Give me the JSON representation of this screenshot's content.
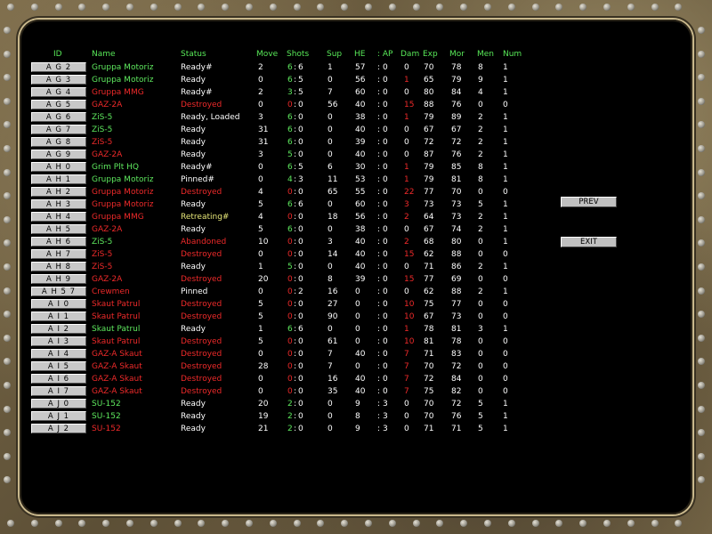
{
  "headers": {
    "id": "ID",
    "name": "Name",
    "status": "Status",
    "move": "Move",
    "shots": "Shots",
    "sup": "Sup",
    "he": "HE",
    "ap": ": AP",
    "dam": "Dam",
    "exp": "Exp",
    "mor": "Mor",
    "men": "Men",
    "num": "Num"
  },
  "colors": {
    "green": "#5ee85e",
    "red": "#ee2a2a",
    "white": "#ffffff",
    "yellow": "#e6e678"
  },
  "buttons": {
    "prev": "PREV",
    "exit": "EXIT"
  },
  "rows": [
    {
      "id": "AG2",
      "name": "Gruppa Motoriz",
      "nc": "g",
      "status": "Ready#",
      "sc": "w",
      "move": "2",
      "shots": "6",
      "sc2": "6",
      "sup": "1",
      "he": "57",
      "ap": "0",
      "dam": "0",
      "dc": "w",
      "exp": "70",
      "mor": "78",
      "men": "8",
      "num": "1"
    },
    {
      "id": "AG3",
      "name": "Gruppa Motoriz",
      "nc": "g",
      "status": "Ready",
      "sc": "w",
      "move": "0",
      "shots": "6",
      "sc2": "5",
      "sup": "0",
      "he": "56",
      "ap": "0",
      "dam": "1",
      "dc": "r",
      "exp": "65",
      "mor": "79",
      "men": "9",
      "num": "1"
    },
    {
      "id": "AG4",
      "name": "Gruppa MMG",
      "nc": "r",
      "status": "Ready#",
      "sc": "w",
      "move": "2",
      "shots": "3",
      "sc2": "5",
      "sup": "7",
      "he": "60",
      "ap": "0",
      "dam": "0",
      "dc": "w",
      "exp": "80",
      "mor": "84",
      "men": "4",
      "num": "1"
    },
    {
      "id": "AG5",
      "name": "GAZ-2A",
      "nc": "r",
      "status": "Destroyed",
      "sc": "r",
      "move": "0",
      "shots": "0",
      "sc2": "0",
      "sup": "56",
      "he": "40",
      "ap": "0",
      "dam": "15",
      "dc": "r",
      "exp": "88",
      "mor": "76",
      "men": "0",
      "num": "0"
    },
    {
      "id": "AG6",
      "name": "ZiS-5",
      "nc": "g",
      "status": "Ready,  Loaded",
      "sc": "w",
      "move": "3",
      "shots": "6",
      "sc2": "0",
      "sup": "0",
      "he": "38",
      "ap": "0",
      "dam": "1",
      "dc": "r",
      "exp": "79",
      "mor": "89",
      "men": "2",
      "num": "1"
    },
    {
      "id": "AG7",
      "name": "ZiS-5",
      "nc": "g",
      "status": "Ready",
      "sc": "w",
      "move": "31",
      "shots": "6",
      "sc2": "0",
      "sup": "0",
      "he": "40",
      "ap": "0",
      "dam": "0",
      "dc": "w",
      "exp": "67",
      "mor": "67",
      "men": "2",
      "num": "1"
    },
    {
      "id": "AG8",
      "name": "ZiS-5",
      "nc": "r",
      "status": "Ready",
      "sc": "w",
      "move": "31",
      "shots": "6",
      "sc2": "0",
      "sup": "0",
      "he": "39",
      "ap": "0",
      "dam": "0",
      "dc": "w",
      "exp": "72",
      "mor": "72",
      "men": "2",
      "num": "1"
    },
    {
      "id": "AG9",
      "name": "GAZ-2A",
      "nc": "r",
      "status": "Ready",
      "sc": "w",
      "move": "3",
      "shots": "5",
      "sc2": "0",
      "sup": "0",
      "he": "40",
      "ap": "0",
      "dam": "0",
      "dc": "w",
      "exp": "87",
      "mor": "76",
      "men": "2",
      "num": "1"
    },
    {
      "id": "AH0",
      "name": "Grim Plt HQ",
      "nc": "g",
      "status": "Ready#",
      "sc": "w",
      "move": "0",
      "shots": "6",
      "sc2": "5",
      "sup": "6",
      "he": "30",
      "ap": "0",
      "dam": "1",
      "dc": "r",
      "exp": "79",
      "mor": "85",
      "men": "8",
      "num": "1"
    },
    {
      "id": "AH1",
      "name": "Gruppa Motoriz",
      "nc": "g",
      "status": "Pinned#",
      "sc": "w",
      "move": "0",
      "shots": "4",
      "sc2": "3",
      "sup": "11",
      "he": "53",
      "ap": "0",
      "dam": "1",
      "dc": "r",
      "exp": "79",
      "mor": "81",
      "men": "8",
      "num": "1"
    },
    {
      "id": "AH2",
      "name": "Gruppa Motoriz",
      "nc": "r",
      "status": "Destroyed",
      "sc": "r",
      "move": "4",
      "shots": "0",
      "sc2": "0",
      "sup": "65",
      "he": "55",
      "ap": "0",
      "dam": "22",
      "dc": "r",
      "exp": "77",
      "mor": "70",
      "men": "0",
      "num": "0"
    },
    {
      "id": "AH3",
      "name": "Gruppa Motoriz",
      "nc": "r",
      "status": "Ready",
      "sc": "w",
      "move": "5",
      "shots": "6",
      "sc2": "6",
      "sup": "0",
      "he": "60",
      "ap": "0",
      "dam": "3",
      "dc": "r",
      "exp": "73",
      "mor": "73",
      "men": "5",
      "num": "1"
    },
    {
      "id": "AH4",
      "name": "Gruppa MMG",
      "nc": "r",
      "status": "Retreating#",
      "sc": "y",
      "move": "4",
      "shots": "0",
      "sc2": "0",
      "sup": "18",
      "he": "56",
      "ap": "0",
      "dam": "2",
      "dc": "r",
      "exp": "64",
      "mor": "73",
      "men": "2",
      "num": "1"
    },
    {
      "id": "AH5",
      "name": "GAZ-2A",
      "nc": "r",
      "status": "Ready",
      "sc": "w",
      "move": "5",
      "shots": "6",
      "sc2": "0",
      "sup": "0",
      "he": "38",
      "ap": "0",
      "dam": "0",
      "dc": "w",
      "exp": "67",
      "mor": "74",
      "men": "2",
      "num": "1"
    },
    {
      "id": "AH6",
      "name": "ZiS-5",
      "nc": "g",
      "status": "Abandoned",
      "sc": "r",
      "move": "10",
      "shots": "0",
      "sc2": "0",
      "sup": "3",
      "he": "40",
      "ap": "0",
      "dam": "2",
      "dc": "r",
      "exp": "68",
      "mor": "80",
      "men": "0",
      "num": "1"
    },
    {
      "id": "AH7",
      "name": "ZiS-5",
      "nc": "r",
      "status": "Destroyed",
      "sc": "r",
      "move": "0",
      "shots": "0",
      "sc2": "0",
      "sup": "14",
      "he": "40",
      "ap": "0",
      "dam": "15",
      "dc": "r",
      "exp": "62",
      "mor": "88",
      "men": "0",
      "num": "0"
    },
    {
      "id": "AH8",
      "name": "ZiS-5",
      "nc": "r",
      "status": "Ready",
      "sc": "w",
      "move": "1",
      "shots": "5",
      "sc2": "0",
      "sup": "0",
      "he": "40",
      "ap": "0",
      "dam": "0",
      "dc": "w",
      "exp": "71",
      "mor": "86",
      "men": "2",
      "num": "1"
    },
    {
      "id": "AH9",
      "name": "GAZ-2A",
      "nc": "r",
      "status": "Destroyed",
      "sc": "r",
      "move": "20",
      "shots": "0",
      "sc2": "0",
      "sup": "8",
      "he": "39",
      "ap": "0",
      "dam": "15",
      "dc": "r",
      "exp": "77",
      "mor": "69",
      "men": "0",
      "num": "0"
    },
    {
      "id": "AH57",
      "name": "Crewmen",
      "nc": "r",
      "status": "Pinned",
      "sc": "w",
      "move": "0",
      "shots": "0",
      "sc2": "2",
      "sup": "16",
      "he": "0",
      "ap": "0",
      "dam": "0",
      "dc": "w",
      "exp": "62",
      "mor": "88",
      "men": "2",
      "num": "1"
    },
    {
      "id": "AI0",
      "name": "Skaut Patrul",
      "nc": "r",
      "status": "Destroyed",
      "sc": "r",
      "move": "5",
      "shots": "0",
      "sc2": "0",
      "sup": "27",
      "he": "0",
      "ap": "0",
      "dam": "10",
      "dc": "r",
      "exp": "75",
      "mor": "77",
      "men": "0",
      "num": "0"
    },
    {
      "id": "AI1",
      "name": "Skaut Patrul",
      "nc": "r",
      "status": "Destroyed",
      "sc": "r",
      "move": "5",
      "shots": "0",
      "sc2": "0",
      "sup": "90",
      "he": "0",
      "ap": "0",
      "dam": "10",
      "dc": "r",
      "exp": "67",
      "mor": "73",
      "men": "0",
      "num": "0"
    },
    {
      "id": "AI2",
      "name": "Skaut Patrul",
      "nc": "g",
      "status": "Ready",
      "sc": "w",
      "move": "1",
      "shots": "6",
      "sc2": "6",
      "sup": "0",
      "he": "0",
      "ap": "0",
      "dam": "1",
      "dc": "r",
      "exp": "78",
      "mor": "81",
      "men": "3",
      "num": "1"
    },
    {
      "id": "AI3",
      "name": "Skaut Patrul",
      "nc": "r",
      "status": "Destroyed",
      "sc": "r",
      "move": "5",
      "shots": "0",
      "sc2": "0",
      "sup": "61",
      "he": "0",
      "ap": "0",
      "dam": "10",
      "dc": "r",
      "exp": "81",
      "mor": "78",
      "men": "0",
      "num": "0"
    },
    {
      "id": "AI4",
      "name": "GAZ-A Skaut",
      "nc": "r",
      "status": "Destroyed",
      "sc": "r",
      "move": "0",
      "shots": "0",
      "sc2": "0",
      "sup": "7",
      "he": "40",
      "ap": "0",
      "dam": "7",
      "dc": "r",
      "exp": "71",
      "mor": "83",
      "men": "0",
      "num": "0"
    },
    {
      "id": "AI5",
      "name": "GAZ-A Skaut",
      "nc": "r",
      "status": "Destroyed",
      "sc": "r",
      "move": "28",
      "shots": "0",
      "sc2": "0",
      "sup": "7",
      "he": "0",
      "ap": "0",
      "dam": "7",
      "dc": "r",
      "exp": "70",
      "mor": "72",
      "men": "0",
      "num": "0"
    },
    {
      "id": "AI6",
      "name": "GAZ-A Skaut",
      "nc": "r",
      "status": "Destroyed",
      "sc": "r",
      "move": "0",
      "shots": "0",
      "sc2": "0",
      "sup": "16",
      "he": "40",
      "ap": "0",
      "dam": "7",
      "dc": "r",
      "exp": "72",
      "mor": "84",
      "men": "0",
      "num": "0"
    },
    {
      "id": "AI7",
      "name": "GAZ-A Skaut",
      "nc": "r",
      "status": "Destroyed",
      "sc": "r",
      "move": "0",
      "shots": "0",
      "sc2": "0",
      "sup": "35",
      "he": "40",
      "ap": "0",
      "dam": "7",
      "dc": "r",
      "exp": "75",
      "mor": "82",
      "men": "0",
      "num": "0"
    },
    {
      "id": "AJ0",
      "name": "SU-152",
      "nc": "g",
      "status": "Ready",
      "sc": "w",
      "move": "20",
      "shots": "2",
      "sc2": "0",
      "sup": "0",
      "he": "9",
      "ap": "3",
      "dam": "0",
      "dc": "w",
      "exp": "70",
      "mor": "72",
      "men": "5",
      "num": "1"
    },
    {
      "id": "AJ1",
      "name": "SU-152",
      "nc": "g",
      "status": "Ready",
      "sc": "w",
      "move": "19",
      "shots": "2",
      "sc2": "0",
      "sup": "0",
      "he": "8",
      "ap": "3",
      "dam": "0",
      "dc": "w",
      "exp": "70",
      "mor": "76",
      "men": "5",
      "num": "1"
    },
    {
      "id": "AJ2",
      "name": "SU-152",
      "nc": "r",
      "status": "Ready",
      "sc": "w",
      "move": "21",
      "shots": "2",
      "sc2": "0",
      "sup": "0",
      "he": "9",
      "ap": "3",
      "dam": "0",
      "dc": "w",
      "exp": "71",
      "mor": "71",
      "men": "5",
      "num": "1"
    }
  ]
}
